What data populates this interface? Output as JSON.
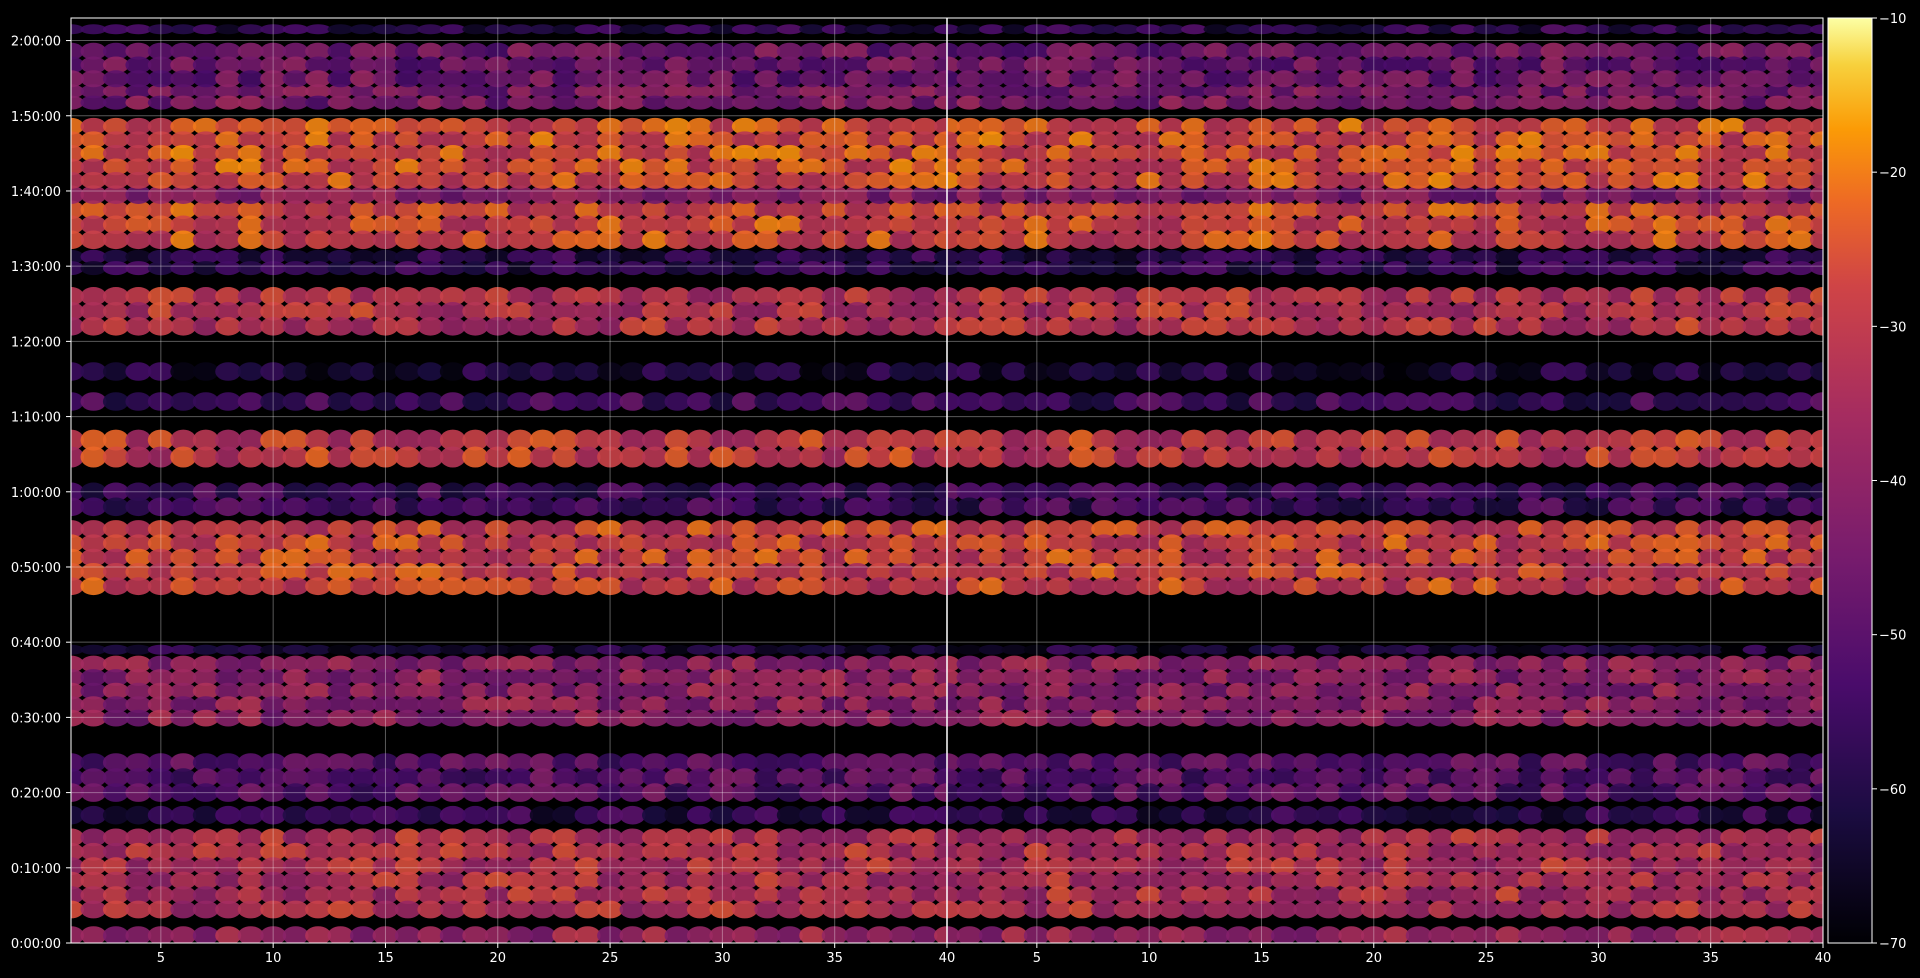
{
  "chart_data": {
    "type": "heatmap",
    "panels": [
      {
        "name": "",
        "x_range": [
          1,
          40
        ],
        "x_ticks": [
          5,
          10,
          15,
          20,
          25,
          30,
          35,
          40
        ]
      },
      {
        "name": "",
        "x_range": [
          1,
          40
        ],
        "x_ticks": [
          5,
          10,
          15,
          20,
          25,
          30,
          35,
          40
        ]
      }
    ],
    "y_axis": {
      "range_seconds": [
        0,
        7380
      ],
      "tick_labels": [
        "0:00:00",
        "0:10:00",
        "0:20:00",
        "0:30:00",
        "0:40:00",
        "0:50:00",
        "1:00:00",
        "1:10:00",
        "1:20:00",
        "1:30:00",
        "1:40:00",
        "1:50:00",
        "2:00:00"
      ]
    },
    "colorbar": {
      "colormap": "inferno",
      "range": [
        -70,
        -10
      ],
      "tick_labels": [
        "−10",
        "−20",
        "−30",
        "−40",
        "−50",
        "−60",
        "−70"
      ]
    },
    "grid": true,
    "x_columns": 40,
    "bands": [
      {
        "start": "0:00:00",
        "end": "0:02:00",
        "level": -38
      },
      {
        "start": "0:03:30",
        "end": "0:15:00",
        "level": -33
      },
      {
        "start": "0:16:00",
        "end": "0:18:00",
        "level": -58
      },
      {
        "start": "0:19:00",
        "end": "0:25:00",
        "level": -50
      },
      {
        "start": "0:29:00",
        "end": "0:38:00",
        "level": -40
      },
      {
        "start": "0:38:30",
        "end": "0:39:30",
        "level": -62
      },
      {
        "start": "0:46:30",
        "end": "0:56:00",
        "level": -28
      },
      {
        "start": "0:57:00",
        "end": "1:01:00",
        "level": -55
      },
      {
        "start": "1:03:30",
        "end": "1:08:00",
        "level": -30
      },
      {
        "start": "1:11:00",
        "end": "1:13:00",
        "level": -55
      },
      {
        "start": "1:15:00",
        "end": "1:17:00",
        "level": -62
      },
      {
        "start": "1:21:00",
        "end": "1:27:00",
        "level": -32
      },
      {
        "start": "1:29:00",
        "end": "1:32:00",
        "level": -58
      },
      {
        "start": "1:32:30",
        "end": "1:38:30",
        "level": -27
      },
      {
        "start": "1:38:30",
        "end": "1:40:30",
        "level": -42
      },
      {
        "start": "1:40:30",
        "end": "1:49:30",
        "level": -26
      },
      {
        "start": "1:51:00",
        "end": "1:54:00",
        "level": -44
      },
      {
        "start": "1:54:00",
        "end": "1:59:30",
        "level": -46
      },
      {
        "start": "2:01:00",
        "end": "2:02:00",
        "level": -58
      }
    ]
  }
}
